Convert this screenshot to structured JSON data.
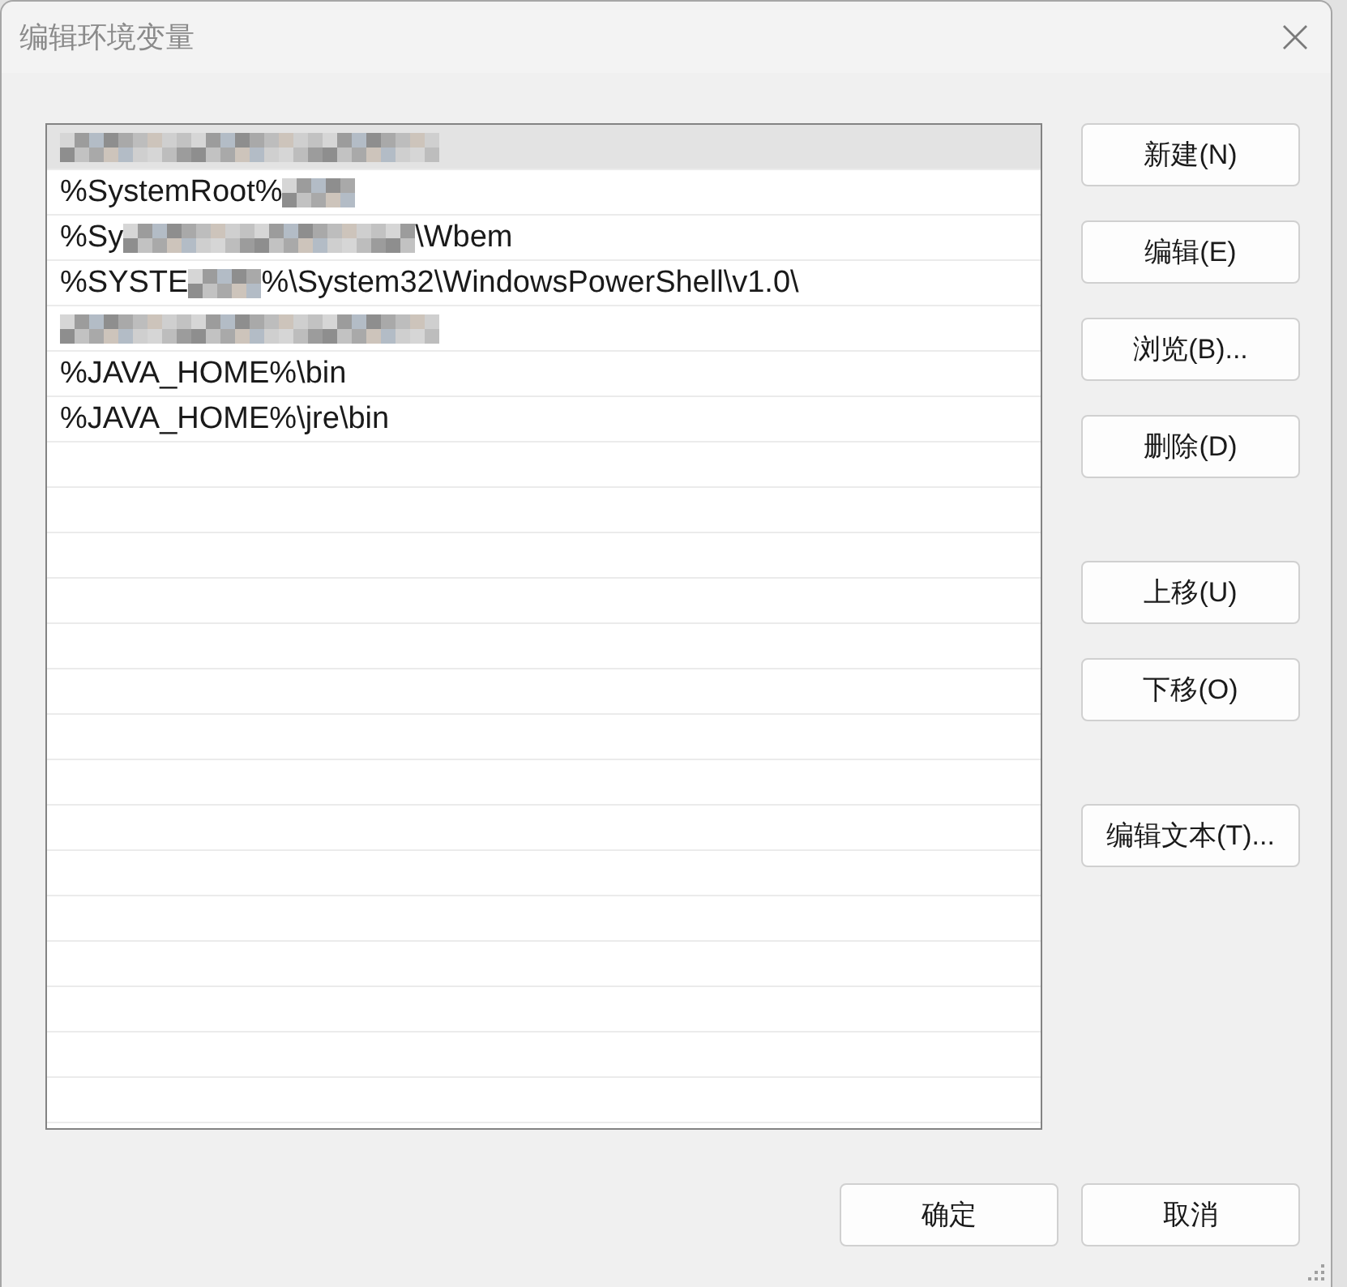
{
  "window": {
    "title": "编辑环境变量"
  },
  "path_list": {
    "rows": [
      {
        "kind": "redacted",
        "selected": true
      },
      {
        "kind": "partial",
        "lead": "%SystemRoot%",
        "selected": false
      },
      {
        "kind": "partial",
        "lead": "%Sy",
        "tail": "\\Wbem",
        "selected": false
      },
      {
        "kind": "partial",
        "lead": "%SYSTE",
        "tail": "%\\System32\\WindowsPowerShell\\v1.0\\",
        "selected": false
      },
      {
        "kind": "redacted",
        "selected": false
      },
      {
        "kind": "text",
        "text": "%JAVA_HOME%\\bin",
        "selected": false
      },
      {
        "kind": "text",
        "text": "%JAVA_HOME%\\jre\\bin",
        "selected": false
      }
    ]
  },
  "side_button_groups": [
    [
      "新建(N)",
      "编辑(E)",
      "浏览(B)...",
      "删除(D)"
    ],
    [
      "上移(U)",
      "下移(O)"
    ],
    [
      "编辑文本(T)..."
    ]
  ],
  "footer_buttons": [
    "确定",
    "取消"
  ]
}
